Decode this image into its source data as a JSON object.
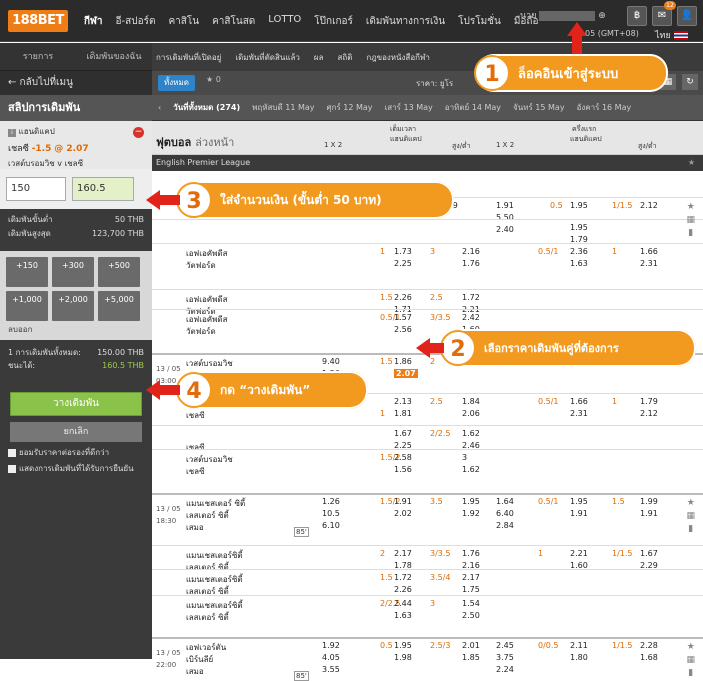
{
  "topbar": {
    "logo": "188BET",
    "nav": [
      "กีฬา",
      "อี-สปอร์ต",
      "คาสิโน",
      "คาสิโนสด",
      "LOTTO",
      "โป๊กเกอร์",
      "เดิมพันทางการเงิน",
      "โปรโมชั่น",
      "มือถือ"
    ],
    "user_prefix": "นาย",
    "timezone": "05 (GMT+08)",
    "language": "ไทย",
    "mail_badge": "12"
  },
  "sidebar": {
    "tabs": [
      "รายการ",
      "เดิมพันของฉัน"
    ],
    "back": "← กลับไปที่เมนู",
    "slip_title": "สลิปการเดิมพัน",
    "bet_type": "แฮนดิแคป",
    "selection_team": "เชลซี",
    "selection_hdp": "-1.5",
    "selection_odds": "@ 2.07",
    "match": "เวสต์บรอมวิช v เชลซี",
    "stake": "150",
    "to_win": "160.5",
    "min_label": "เดิมพันขั้นต่ำ",
    "min_value": "50 THB",
    "max_label": "เดิมพันสูงสุด",
    "max_value": "123,700 THB",
    "quick": [
      "+150",
      "+300",
      "+500",
      "+1,000",
      "+2,000",
      "+5,000"
    ],
    "clear": "ลบออก",
    "total_label": "1 การเดิมพันทั้งหมด:",
    "total_value": "150.00 THB",
    "win_label": "ชนะได้:",
    "win_value": "160.5 THB",
    "place_bet": "วางเดิมพัน",
    "cancel": "ยกเลิก",
    "check1": "ยอมรับราคาต่อรองที่ดีกว่า",
    "check2": "แสดงการเดิมพันที่ได้รับการยืนยัน"
  },
  "main": {
    "subnav": [
      "การเดิมพันที่เปิดอยู่",
      "เดิมพันที่ตัดสินแล้ว",
      "ผล",
      "สถิติ",
      "กฎของหนังสือกีฬา"
    ],
    "filter_all": "ทั้งหมด",
    "fav_count": "★ 0",
    "price_label": "ราคา: ยูโร",
    "dates": [
      "วันที่ทั้งหมด (274)",
      "พฤหัสบดี 11 May",
      "ศุกร์ 12 May",
      "เสาร์ 13 May",
      "อาทิตย์ 14 May",
      "จันทร์ 15 May",
      "อังคาร์ 16 May"
    ],
    "section_title": "ฟุตบอล",
    "section_sub": "ล่วงหน้า",
    "ft_label": "เต็มเวลา",
    "ht_label": "ครึ่งแรก",
    "col_1x2": "1 X 2",
    "col_hdp": "แฮนดิแคป",
    "col_ou": "สูง/ต่ำ",
    "league": "English Premier League"
  },
  "rows": [
    {
      "time": "",
      "teams": [
        "",
        "",
        ""
      ],
      "x12": [
        "",
        "",
        ""
      ],
      "hdp": [
        "",
        "1.89"
      ],
      "ou": [
        "",
        ""
      ],
      "h1": [
        "1.91",
        "5.50",
        "2.40"
      ],
      "hh": [
        "0.5",
        "1.95"
      ],
      "hou": [
        "1/1.5",
        "2.12"
      ]
    },
    {
      "x12b": [
        "",
        "1.95",
        "1.79"
      ]
    },
    {
      "teams": [
        "เอฟเอคัพดีส",
        "วัตฟอร์ด"
      ],
      "hcap": "1",
      "a": "1.73",
      "b": "2.25",
      "ouv": "3",
      "c": "2.16",
      "d": "1.76",
      "hh": "0.5/1",
      "e": "2.36",
      "f": "1.63",
      "hou": "1",
      "g": "1.66",
      "h": "2.31"
    },
    {
      "teams": [
        "เอฟเอคัพดีส",
        "วัตฟอร์ด"
      ],
      "hcap": "1.5",
      "a": "2.26",
      "b": "1.71",
      "ouv": "2.5",
      "c": "1.72",
      "d": "2.21"
    },
    {
      "teams": [
        "เอฟเอคัพดีส",
        "วัตฟอร์ด"
      ],
      "hcap": "0.5/1",
      "a": "1.57",
      "b": "2.56",
      "ouv": "3/3.5",
      "c": "2.42",
      "d": "1.60"
    },
    {
      "time": "13 / 05",
      "clock": "03:00",
      "teams": [
        "เวสต์บรอมวิช",
        "เชลซี",
        "เสมอ"
      ],
      "x12": [
        "9.40",
        "1.36",
        "5.00"
      ],
      "hcap": "1.5",
      "a": "1.86",
      "sel": "2.07",
      "ouv": "2",
      "c": "",
      "d": ""
    },
    {
      "teams": [
        "",
        "เชลซี"
      ],
      "hcap1": "1",
      "a": "2.13",
      "b": "1.81",
      "ouv": "2.5",
      "c": "1.84",
      "d": "2.06",
      "e": "1.66",
      "f": "2.31",
      "hou": "1",
      "g": "1.79",
      "h": "2.12",
      "hh": "0.5/1"
    },
    {
      "teams": [
        "",
        "เชลซี"
      ],
      "a": "1.67",
      "b": "2.25",
      "ouv": "2/2.5",
      "c": "1.62",
      "d": "2.46"
    },
    {
      "teams": [
        "เวสต์บรอมวิช",
        "เชลซี"
      ],
      "hcap": "1.5/2",
      "a": "2.58",
      "b": "1.56",
      "c": "3",
      "d": "1.62"
    },
    {
      "time": "13 / 05",
      "clock": "18:30",
      "teams": [
        "แมนเชสเตอร์ ซิตี้",
        "เลสเตอร์ ซิตี้",
        "เสมอ"
      ],
      "x12": [
        "1.26",
        "10.5",
        "6.10"
      ],
      "hcap": "1.5/2",
      "a": "1.91",
      "b": "2.02",
      "ouv": "3.5",
      "c": "1.95",
      "d": "1.92",
      "h1": [
        "1.64",
        "6.40",
        "2.84"
      ],
      "hh": "0.5/1",
      "e": "1.95",
      "f": "1.91",
      "hou": "1.5",
      "g": "1.99",
      "h": "1.91"
    },
    {
      "teams": [
        "แมนเชสเตอร์ซิตี้",
        "เลสเตอร์ ซิตี้"
      ],
      "hcap": "2",
      "a": "2.17",
      "b": "1.78",
      "ouv": "3/3.5",
      "c": "1.76",
      "d": "2.16",
      "hh": "1",
      "e": "2.21",
      "f": "1.60",
      "hou": "1/1.5",
      "g": "1.67",
      "h": "2.29"
    },
    {
      "teams": [
        "แมนเชสเตอร์ซิตี้",
        "เลสเตอร์ ซิตี้"
      ],
      "hcap": "1.5",
      "a": "1.72",
      "b": "2.26",
      "ouv": "3.5/4",
      "c": "2.17",
      "d": "1.75"
    },
    {
      "teams": [
        "แมนเชสเตอร์ซิตี้",
        "เลสเตอร์ ซิตี้"
      ],
      "hcap": "2/2.5",
      "a": "2.44",
      "b": "1.63",
      "ouv": "3",
      "c": "1.54",
      "d": "2.50"
    },
    {
      "time": "13 / 05",
      "clock": "22:00",
      "teams": [
        "เอฟเวอร์ตัน",
        "เบิร์นลีย์",
        "เสมอ"
      ],
      "x12": [
        "1.92",
        "4.05",
        "3.55"
      ],
      "hcap": "0.5",
      "a": "1.95",
      "b": "1.98",
      "ouv": "2.5/3",
      "c": "2.01",
      "d": "1.85",
      "h1": [
        "2.45",
        "3.75",
        "2.24"
      ],
      "hh": "0/0.5",
      "e": "2.11",
      "f": "1.80",
      "hou": "1/1.5",
      "g": "2.28",
      "h": "1.68"
    }
  ],
  "callouts": {
    "c1_num": "1",
    "c1_text": "ล็อคอินเข้าสู่ระบบ",
    "c2_num": "2",
    "c2_text": "เลือกราคาเดิมพันคู่ที่ต้องการ",
    "c3_num": "3",
    "c3_text": "ใส่จำนวนเงิน (ขั้นต่ำ 50 บาท)",
    "c4_num": "4",
    "c4_text": "กด “วางเดิมพัน”"
  },
  "tv_label": "85'",
  "colors": {
    "accent": "#ee7d16",
    "callout": "#f29a1f",
    "arrow": "#e2231a",
    "place_bet": "#8bc34a"
  }
}
